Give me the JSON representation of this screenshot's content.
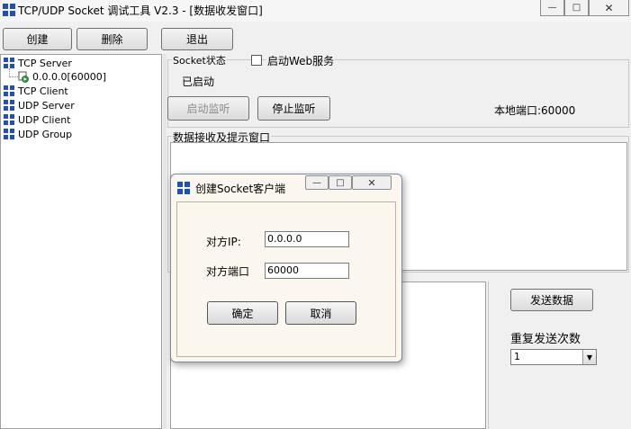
{
  "window": {
    "title": "TCP/UDP Socket 调试工具 V2.3 - [数据收发窗口]"
  },
  "toolbar": {
    "create_label": "创建",
    "delete_label": "删除",
    "exit_label": "退出"
  },
  "tree": {
    "items": [
      {
        "label": "TCP Server"
      },
      {
        "label": "0.0.0.0[60000]"
      },
      {
        "label": "TCP Client"
      },
      {
        "label": "UDP Server"
      },
      {
        "label": "UDP Client"
      },
      {
        "label": "UDP Group"
      }
    ]
  },
  "socket_status": {
    "legend": "Socket状态",
    "web_service_label": "启动Web服务",
    "web_service_checked": false,
    "status_text": "已启动",
    "start_listen_label": "启动监听",
    "stop_listen_label": "停止监听",
    "local_port_text": "本地端口:60000"
  },
  "receive_panel": {
    "legend": "数据接收及提示窗口"
  },
  "send_panel": {
    "send_button_label": "发送数据",
    "repeat_label": "重复发送次数",
    "repeat_value": "1"
  },
  "dialog": {
    "title": "创建Socket客户端",
    "ip_label": "对方IP:",
    "ip_value": "0.0.0.0",
    "port_label": "对方端口",
    "port_value": "60000",
    "ok_label": "确定",
    "cancel_label": "取消"
  },
  "colors": {
    "icon_blue": "#1f4fbf",
    "icon_green": "#2e8b3a"
  }
}
